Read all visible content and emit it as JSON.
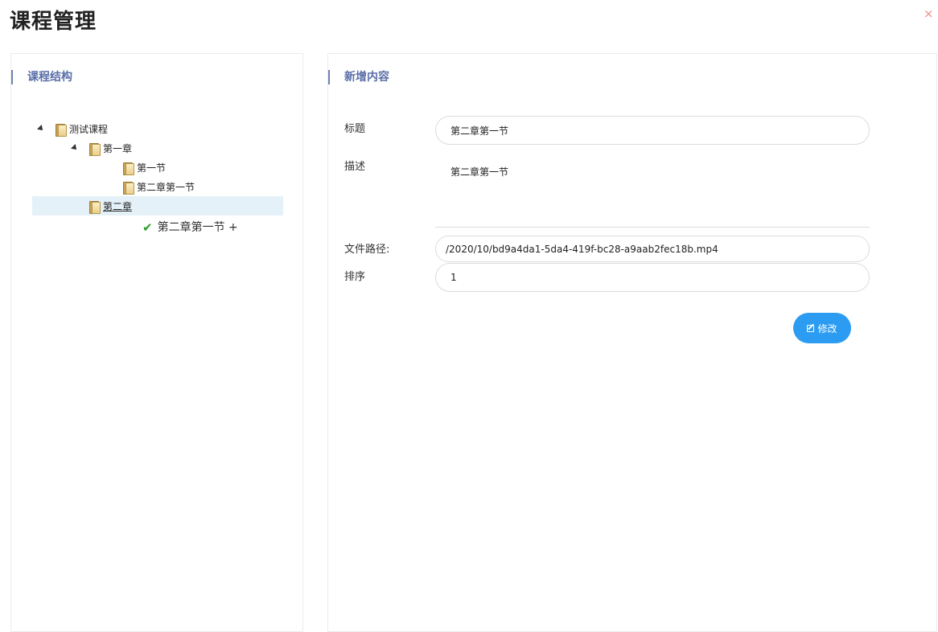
{
  "header": {
    "title": "课程管理",
    "close_symbol": "×"
  },
  "left_panel": {
    "title": "课程结构",
    "tree": [
      {
        "label": "测试课程",
        "level": 0
      },
      {
        "label": "第一章",
        "level": 1
      },
      {
        "label": "第一节",
        "level": 2
      },
      {
        "label": "第二章第一节",
        "level": 2
      },
      {
        "label": "第二章",
        "level": 1,
        "selected": true
      },
      {
        "label": "第二章第一节 +",
        "level": 2,
        "new": true
      }
    ]
  },
  "right_panel": {
    "title": "新增内容",
    "fields": {
      "title_label": "标题",
      "title_value": "第二章第一节",
      "desc_label": "描述",
      "desc_value": "第二章第一节",
      "path_label": "文件路径:",
      "path_value": "/2020/10/bd9a4da1-5da4-419f-bc28-a9aab2fec18b.mp4",
      "order_label": "排序",
      "order_value": "1"
    },
    "save_label": "修改"
  },
  "colors": {
    "accent": "#2b9cf2",
    "heading": "#5a6fa8",
    "selected_bg": "#e4f1f8"
  }
}
